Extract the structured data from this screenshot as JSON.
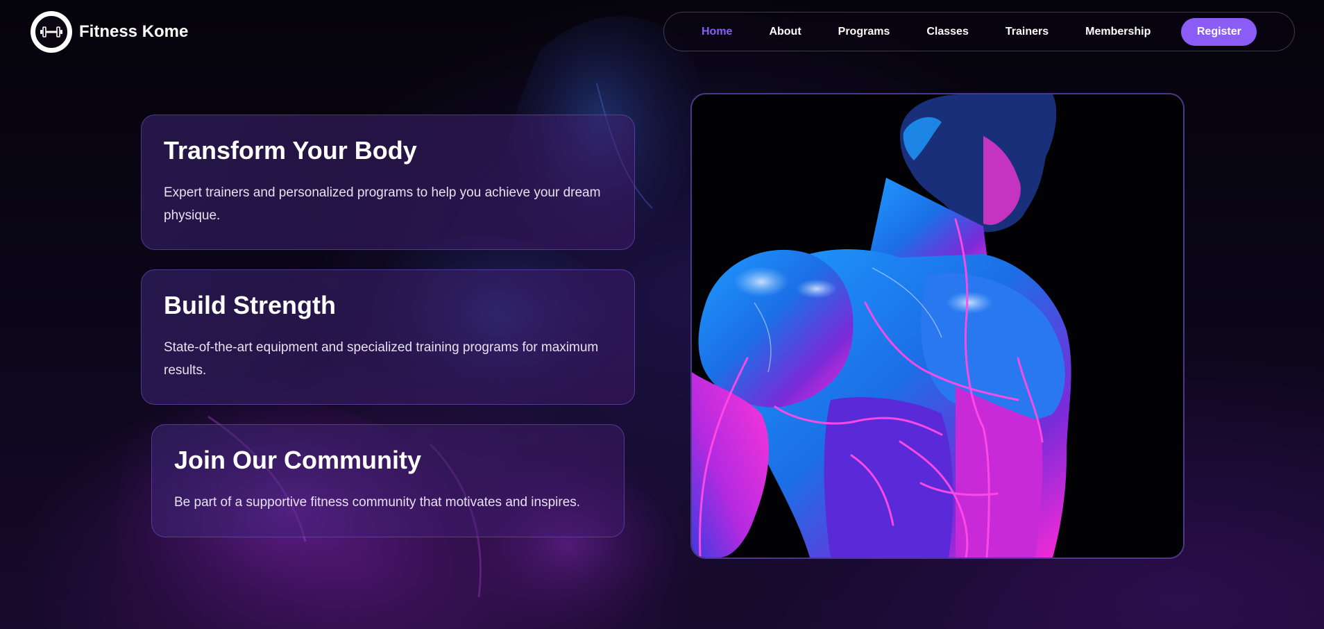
{
  "brand": {
    "name": "Fitness Kome",
    "logo_icon": "dumbbell-icon"
  },
  "nav": {
    "links": [
      {
        "label": "Home",
        "active": true
      },
      {
        "label": "About",
        "active": false
      },
      {
        "label": "Programs",
        "active": false
      },
      {
        "label": "Classes",
        "active": false
      },
      {
        "label": "Trainers",
        "active": false
      },
      {
        "label": "Membership",
        "active": false
      }
    ],
    "register_label": "Register"
  },
  "features": [
    {
      "title": "Transform Your Body",
      "text": "Expert trainers and personalized programs to help you achieve your dream physique."
    },
    {
      "title": "Build Strength",
      "text": "State-of-the-art equipment and specialized training programs for maximum results."
    },
    {
      "title": "Join Our Community",
      "text": "Be part of a supportive fitness community that motivates and inspires."
    }
  ],
  "colors": {
    "accent": "#8b5cf6",
    "background": "#07040e",
    "card_border": "#6d56c8",
    "neon_blue": "#1d8cff",
    "neon_magenta": "#ff2bd6"
  }
}
